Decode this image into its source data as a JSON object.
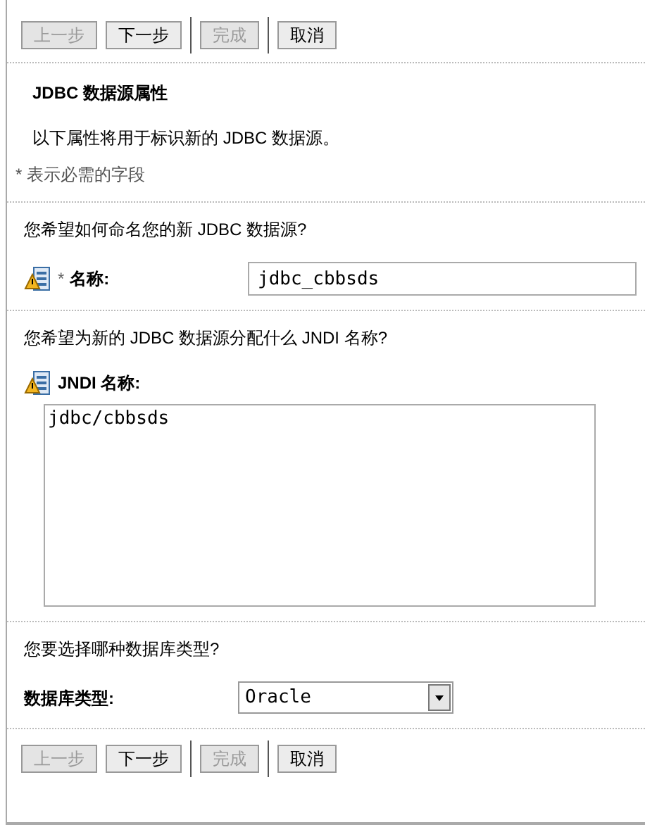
{
  "top_toolbar": [
    {
      "label": "上一步",
      "disabled": true,
      "separator_before": false
    },
    {
      "label": "下一步",
      "disabled": false,
      "separator_before": false
    },
    {
      "label": "完成",
      "disabled": true,
      "separator_before": true
    },
    {
      "label": "取消",
      "disabled": false,
      "separator_before": true
    }
  ],
  "title": "JDBC 数据源属性",
  "description": "以下属性将用于标识新的 JDBC 数据源。",
  "required_note": "* 表示必需的字段",
  "sections": [
    {
      "kind": "input",
      "question": "您希望如何命名您的新 JDBC 数据源?",
      "required_mark": "*",
      "label": "名称:",
      "value": "jdbc_cbbsds",
      "has_icon": true
    },
    {
      "kind": "textarea",
      "question": "您希望为新的 JDBC 数据源分配什么 JNDI 名称?",
      "label": "JNDI 名称:",
      "value": "jdbc/cbbsds",
      "has_icon": true
    },
    {
      "kind": "select",
      "question": "您要选择哪种数据库类型?",
      "label": "数据库类型:",
      "value": "Oracle",
      "has_icon": false
    }
  ],
  "bottom_toolbar": [
    {
      "label": "上一步",
      "disabled": true,
      "separator_before": false
    },
    {
      "label": "下一步",
      "disabled": false,
      "separator_before": false
    },
    {
      "label": "完成",
      "disabled": true,
      "separator_before": true
    },
    {
      "label": "取消",
      "disabled": false,
      "separator_before": true
    }
  ]
}
